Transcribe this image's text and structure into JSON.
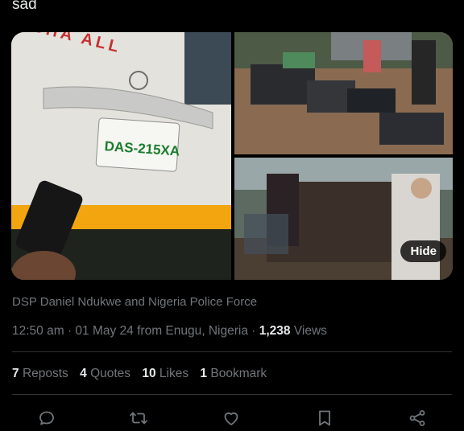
{
  "tweet": {
    "text": "sad"
  },
  "media": {
    "plate_text": "DAS-215XA",
    "bus_lettering": "ASHA ALL",
    "hide_label": "Hide"
  },
  "attribution": "DSP Daniel Ndukwe and Nigeria Police Force",
  "meta": {
    "time": "12:50 am",
    "date": "01 May 24",
    "source": "from Enugu, Nigeria",
    "views_count": "1,238",
    "views_label": "Views"
  },
  "stats": {
    "reposts_count": "7",
    "reposts_label": "Reposts",
    "quotes_count": "4",
    "quotes_label": "Quotes",
    "likes_count": "10",
    "likes_label": "Likes",
    "bookmarks_count": "1",
    "bookmarks_label": "Bookmark"
  },
  "actions": [
    "reply-icon",
    "repost-icon",
    "like-icon",
    "bookmark-icon",
    "share-icon"
  ],
  "colors": {
    "background": "#000000",
    "text": "#e7e9ea",
    "muted": "#71767b",
    "divider": "#2f3336"
  }
}
